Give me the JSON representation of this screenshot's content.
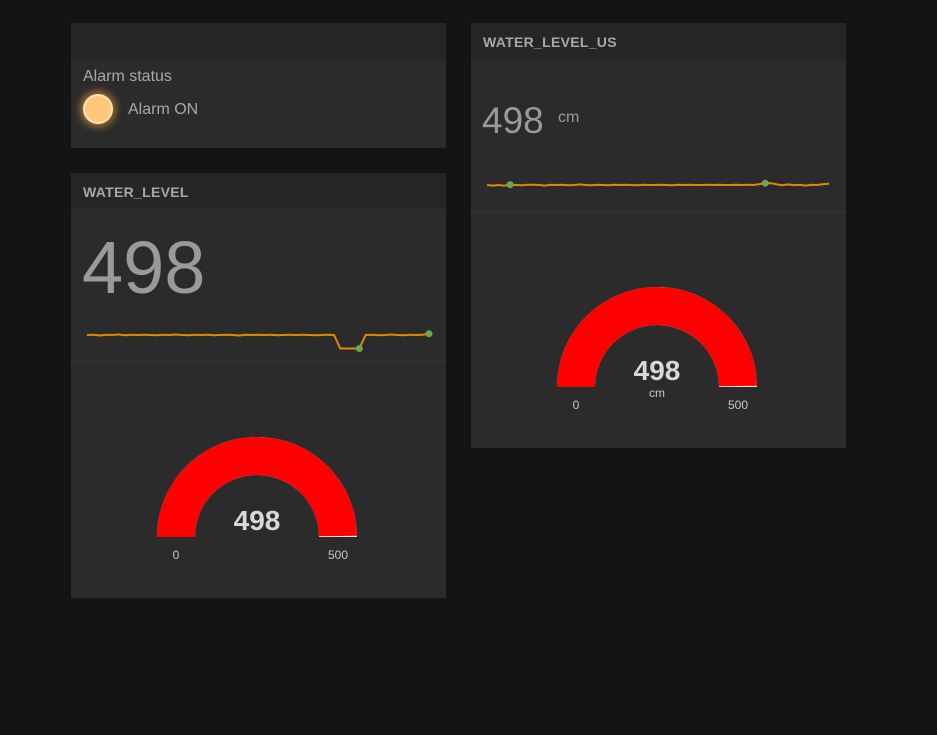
{
  "colors": {
    "background": "#131415",
    "card": "#2b2b2b",
    "card_header": "#262626",
    "text": "#a8a8a8",
    "gauge_fill": "#ff0000",
    "sparkline": "#e08a00",
    "sparkline_dot": "#6aa84f",
    "alarm_led": "#ffc77a"
  },
  "alarm": {
    "title": "",
    "label": "Alarm status",
    "state_text": "Alarm ON",
    "led_icon": "alarm-led-icon"
  },
  "water_level": {
    "title": "WATER_LEVEL",
    "value": "498",
    "gauge": {
      "value": "498",
      "unit": "",
      "min_label": "0",
      "max_label": "500",
      "min": 0,
      "max": 500,
      "current": 498
    },
    "sparkline": [
      0.0,
      0.05,
      -0.1,
      0.05,
      0.0,
      0.1,
      -0.05,
      0.05,
      0.0,
      0.05,
      0.0,
      -0.05,
      0.05,
      0.0,
      0.1,
      0.0,
      -0.05,
      0.05,
      0.0,
      0.05,
      -0.05,
      0.0,
      0.05,
      0.0,
      -0.1,
      0.05,
      0.0,
      0.05,
      0.0,
      0.05,
      -0.05,
      0.0,
      0.05,
      0.0,
      0.05,
      0.0,
      -0.05,
      0.0,
      0.05,
      0.0,
      -2.7,
      -2.7,
      -2.7,
      -2.7,
      0.0,
      0.05,
      -0.05,
      0.0,
      0.1,
      0.0,
      -0.05,
      0.05,
      0.0,
      0.05,
      0.25
    ],
    "sparkline_dots": [
      43,
      54
    ]
  },
  "water_level_us": {
    "title": "WATER_LEVEL_US",
    "value": "498",
    "unit": "cm",
    "gauge": {
      "value": "498",
      "unit": "cm",
      "min_label": "0",
      "max_label": "500",
      "min": 0,
      "max": 500,
      "current": 498
    },
    "sparkline": [
      0.0,
      -0.1,
      0.0,
      -0.1,
      0.05,
      0.0,
      -0.05,
      0.05,
      0.05,
      0.0,
      -0.1,
      0.05,
      0.0,
      0.05,
      -0.05,
      0.0,
      0.1,
      0.0,
      -0.05,
      0.05,
      0.0,
      -0.05,
      0.05,
      0.0,
      0.05,
      0.0,
      -0.05,
      0.05,
      0.0,
      0.0,
      0.05,
      0.0,
      -0.05,
      0.05,
      0.0,
      0.05,
      0.0,
      0.0,
      0.05,
      0.0,
      0.05,
      0.0,
      0.0,
      0.05,
      0.0,
      0.05,
      0.0,
      0.15,
      0.3,
      0.3,
      0.1,
      -0.05,
      0.1,
      -0.05,
      0.05,
      -0.1,
      0.05,
      0.0,
      0.15,
      0.2
    ],
    "sparkline_dots": [
      4,
      48
    ]
  }
}
